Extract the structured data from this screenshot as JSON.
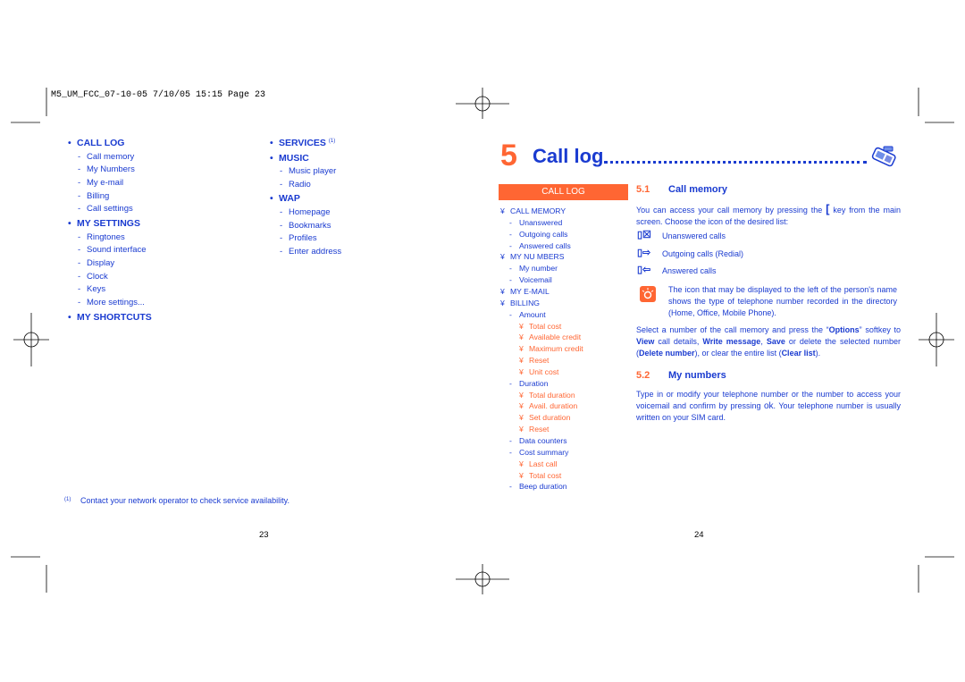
{
  "header": "M5_UM_FCC_07-10-05   7/10/05   15:15   Page 23",
  "left_page": {
    "col1": [
      {
        "title": "CALL LOG",
        "items": [
          "Call memory",
          "My Numbers",
          "My e-mail",
          "Billing",
          "Call settings"
        ]
      },
      {
        "title": "MY SETTINGS",
        "items": [
          "Ringtones",
          "Sound interface",
          "Display",
          "Clock",
          "Keys",
          "More settings..."
        ]
      },
      {
        "title": "MY SHORTCUTS",
        "items": []
      }
    ],
    "col2": [
      {
        "title": "SERVICES",
        "sup": "(1)",
        "items": []
      },
      {
        "title": "MUSIC",
        "items": [
          "Music player",
          "Radio"
        ]
      },
      {
        "title": "WAP",
        "items": [
          "Homepage",
          "Bookmarks",
          "Profiles",
          "Enter address"
        ]
      }
    ],
    "footnote_mark": "(1)",
    "footnote": "Contact your network operator to check service availability.",
    "page_number": "23"
  },
  "right_page": {
    "chapter_number": "5",
    "chapter_title": "Call log",
    "menu_header": "CALL LOG",
    "menu": [
      {
        "lvl": 0,
        "t": "CALL MEMORY"
      },
      {
        "lvl": 1,
        "t": "Unanswered"
      },
      {
        "lvl": 1,
        "t": "Outgoing calls"
      },
      {
        "lvl": 1,
        "t": "Answered calls"
      },
      {
        "lvl": 0,
        "t": "MY NU  MBERS"
      },
      {
        "lvl": 1,
        "t": "My number"
      },
      {
        "lvl": 1,
        "t": "Voicemail"
      },
      {
        "lvl": 0,
        "t": "MY E-MAIL"
      },
      {
        "lvl": 0,
        "t": "BILLING"
      },
      {
        "lvl": 1,
        "t": "Amount"
      },
      {
        "lvl": 2,
        "t": "Total cost"
      },
      {
        "lvl": 2,
        "t": "Available credit"
      },
      {
        "lvl": 2,
        "t": "Maximum credit"
      },
      {
        "lvl": 2,
        "t": "Reset"
      },
      {
        "lvl": 2,
        "t": "Unit cost"
      },
      {
        "lvl": 1,
        "t": "Duration"
      },
      {
        "lvl": 2,
        "t": "Total duration"
      },
      {
        "lvl": 2,
        "t": "Avail. duration"
      },
      {
        "lvl": 2,
        "t": "Set duration"
      },
      {
        "lvl": 2,
        "t": "Reset"
      },
      {
        "lvl": 1,
        "t": "Data counters"
      },
      {
        "lvl": 1,
        "t": "Cost summary"
      },
      {
        "lvl": 2,
        "t": "Last call"
      },
      {
        "lvl": 2,
        "t": "Total cost"
      },
      {
        "lvl": 1,
        "t": "Beep duration"
      }
    ],
    "s51": {
      "num": "5.1",
      "title": "Call memory",
      "p1a": "You can access your call memory by pressing the",
      "p1b": "key from the main screen. Choose the icon of the desired list:",
      "icons": [
        "Unanswered calls",
        "Outgoing calls (Redial)",
        "Answered calls"
      ],
      "tip": "The icon that may be displayed to the left of the person's name shows the type of telephone number recorded in the directory (Home, Office, Mobile Phone).",
      "p2": [
        "Select a number of the call memory and press the “",
        "Options",
        "” softkey to ",
        "View",
        " call details, ",
        "Write message",
        ", ",
        "Save",
        " or delete the selected number (",
        "Delete number",
        "), or clear the entire list (",
        "Clear list",
        "). "
      ]
    },
    "s52": {
      "num": "5.2",
      "title": "My numbers",
      "p1a": "Type in or modify your telephone number or the number to access your voicemail and confirm by pressing",
      "ok": "ok",
      "p1b": ". Your telephone number is usually written on your SIM card."
    },
    "page_number": "24"
  },
  "colors": {
    "blue": "#1a3bd0",
    "orange": "#ff6633"
  }
}
